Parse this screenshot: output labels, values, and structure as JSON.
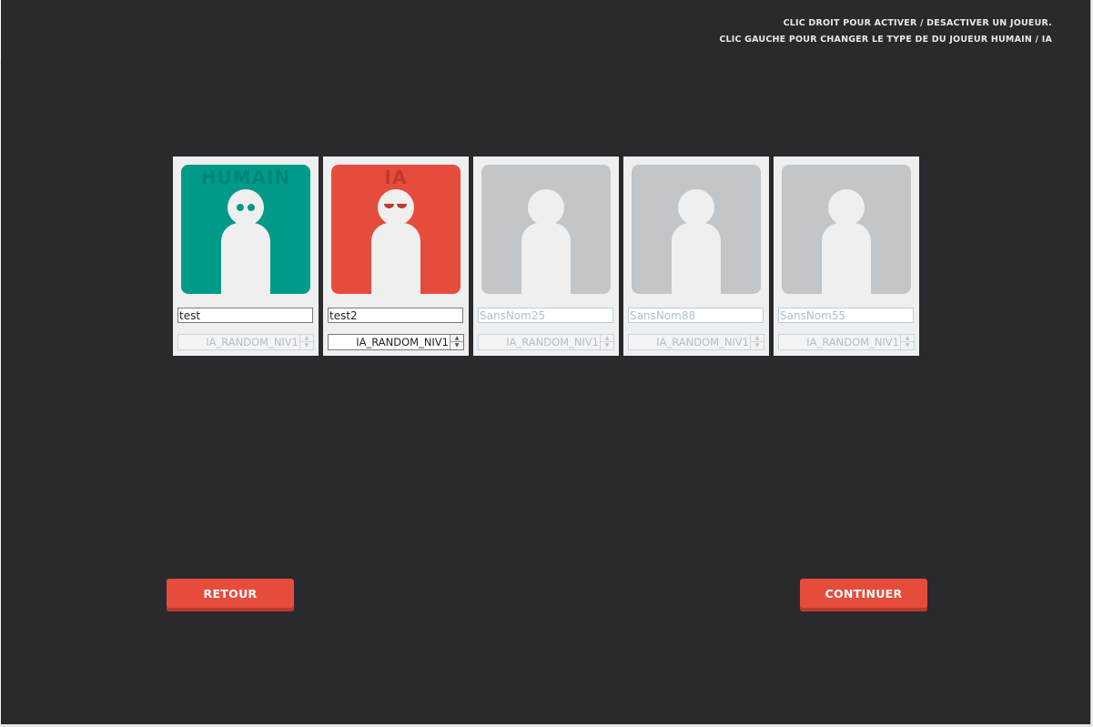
{
  "instructions": {
    "line1": "CLIC DROIT POUR ACTIVER / DESACTIVER UN JOUEUR.",
    "line2": "CLIC GAUCHE POUR CHANGER LE TYPE DE DU JOUEUR HUMAIN / IA"
  },
  "players": [
    {
      "type": "humain",
      "type_label": "HUMAIN",
      "active": true,
      "name": "test",
      "ai_level": "IA_RANDOM_NIV1"
    },
    {
      "type": "ia",
      "type_label": "IA",
      "active": true,
      "name": "test2",
      "ai_level": "IA_RANDOM_NIV1"
    },
    {
      "type": "inactive",
      "type_label": "",
      "active": false,
      "name": "SansNom25",
      "ai_level": "IA_RANDOM_NIV1"
    },
    {
      "type": "inactive",
      "type_label": "",
      "active": false,
      "name": "SansNom88",
      "ai_level": "IA_RANDOM_NIV1"
    },
    {
      "type": "inactive",
      "type_label": "",
      "active": false,
      "name": "SansNom55",
      "ai_level": "IA_RANDOM_NIV1"
    }
  ],
  "buttons": {
    "back": "RETOUR",
    "continue": "CONTINUER"
  },
  "colors": {
    "background": "#2a2a2e",
    "humain": "#009a8a",
    "ia": "#e64c3c",
    "inactive": "#c3c6c9",
    "button": "#e64c3c"
  },
  "icons": {
    "avatar": "person-silhouette-icon",
    "spinner_up": "arrow-up-icon",
    "spinner_down": "arrow-down-icon"
  }
}
